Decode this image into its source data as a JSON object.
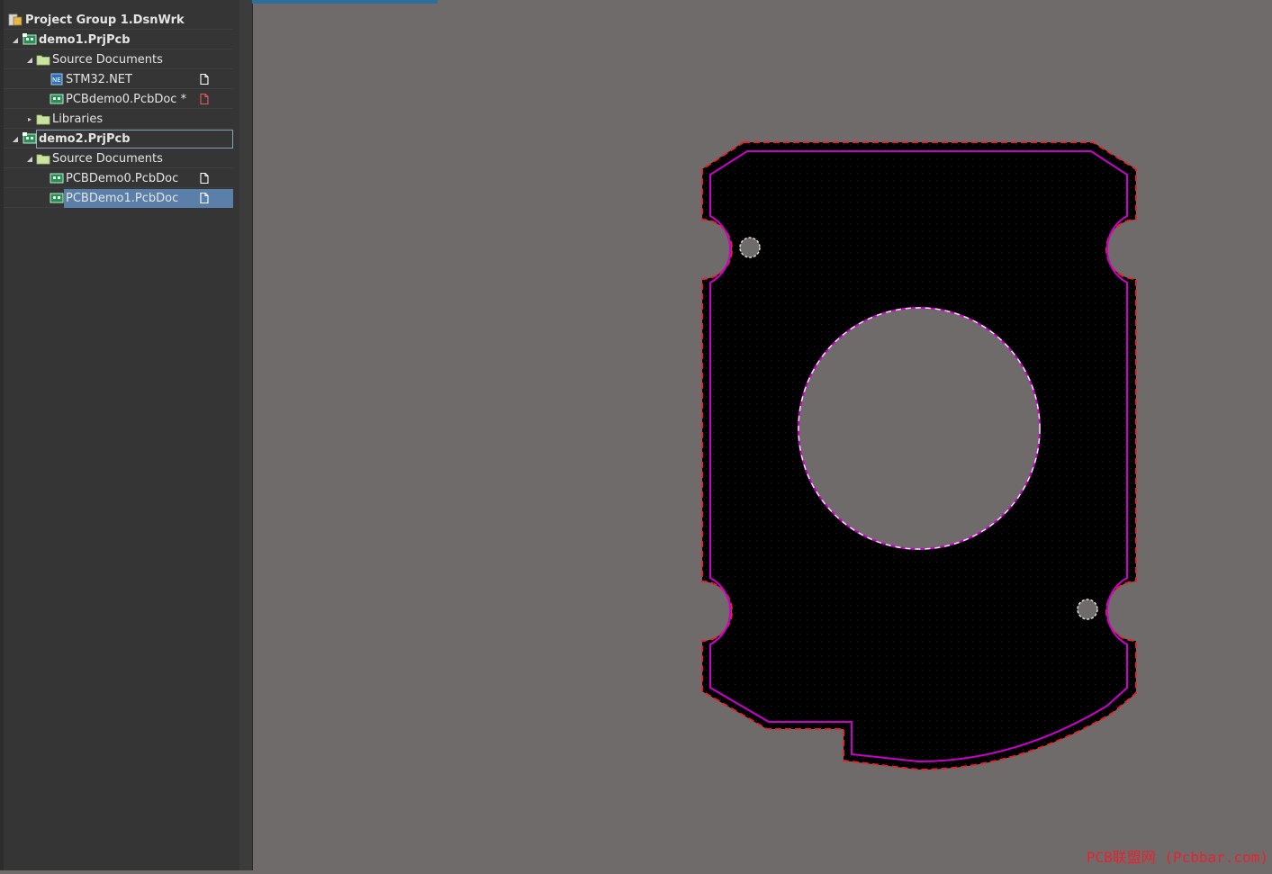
{
  "panel": {
    "items": [
      {
        "label": "Project Group 1.DsnWrk",
        "level": 0,
        "arrow": "",
        "icon": "project-group-icon",
        "bold": true,
        "doc": ""
      },
      {
        "label": "demo1.PrjPcb",
        "level": 1,
        "arrow": "expanded",
        "icon": "pcb-project-icon",
        "bold": true,
        "doc": ""
      },
      {
        "label": "Source Documents",
        "level": 2,
        "arrow": "expanded",
        "icon": "folder-icon",
        "bold": false,
        "doc": ""
      },
      {
        "label": "STM32.NET",
        "level": 3,
        "arrow": "",
        "icon": "netlist-file-icon",
        "bold": false,
        "doc": "saved"
      },
      {
        "label": "PCBdemo0.PcbDoc *",
        "level": 3,
        "arrow": "",
        "icon": "pcb-doc-icon",
        "bold": false,
        "doc": "modified"
      },
      {
        "label": "Libraries",
        "level": 2,
        "arrow": "collapsed",
        "icon": "folder-icon",
        "bold": false,
        "doc": ""
      },
      {
        "label": "demo2.PrjPcb",
        "level": 1,
        "arrow": "expanded",
        "icon": "pcb-project-icon",
        "bold": true,
        "doc": "",
        "focused": true
      },
      {
        "label": "Source Documents",
        "level": 2,
        "arrow": "expanded",
        "icon": "folder-icon",
        "bold": false,
        "doc": ""
      },
      {
        "label": "PCBDemo0.PcbDoc",
        "level": 3,
        "arrow": "",
        "icon": "pcb-doc-icon",
        "bold": false,
        "doc": "saved"
      },
      {
        "label": "PCBDemo1.PcbDoc",
        "level": 3,
        "arrow": "",
        "icon": "pcb-doc-icon",
        "bold": false,
        "doc": "saved",
        "selected": true
      }
    ]
  },
  "colors": {
    "panel_bg": "#353535",
    "canvas_bg": "#6f6b6b",
    "board_fill": "#000000",
    "board_outline": "#e8222e",
    "keepout": "#cc00cc",
    "selection": "#5a7fa8",
    "watermark": "#e8222e"
  },
  "watermark": "PCB联盟网 (Pcbbar.com)"
}
